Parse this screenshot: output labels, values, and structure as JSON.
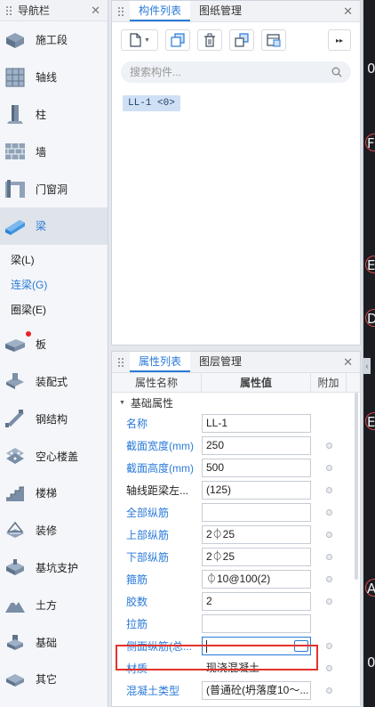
{
  "nav": {
    "title": "导航栏",
    "items": [
      {
        "label": "施工段",
        "icon": "construction-segment-icon"
      },
      {
        "label": "轴线",
        "icon": "axis-grid-icon"
      },
      {
        "label": "柱",
        "icon": "column-icon"
      },
      {
        "label": "墙",
        "icon": "wall-icon"
      },
      {
        "label": "门窗洞",
        "icon": "door-window-icon"
      },
      {
        "label": "梁",
        "icon": "beam-icon"
      },
      {
        "label": "板",
        "icon": "slab-icon"
      },
      {
        "label": "装配式",
        "icon": "prefab-icon"
      },
      {
        "label": "钢结构",
        "icon": "steel-structure-icon"
      },
      {
        "label": "空心楼盖",
        "icon": "hollow-floor-icon"
      },
      {
        "label": "楼梯",
        "icon": "stair-icon"
      },
      {
        "label": "装修",
        "icon": "decoration-icon"
      },
      {
        "label": "基坑支护",
        "icon": "foundation-pit-icon"
      },
      {
        "label": "土方",
        "icon": "earthwork-icon"
      },
      {
        "label": "基础",
        "icon": "foundation-icon"
      },
      {
        "label": "其它",
        "icon": "other-icon"
      }
    ],
    "sub_items": [
      "梁(L)",
      "连梁(G)",
      "圈梁(E)"
    ]
  },
  "component_panel": {
    "tabs": [
      "构件列表",
      "图纸管理"
    ],
    "search_placeholder": "搜索构件...",
    "component": "LL-1 <0>"
  },
  "property_panel": {
    "tabs": [
      "属性列表",
      "图层管理"
    ],
    "headers": {
      "name": "属性名称",
      "value": "属性值",
      "extra": "附加"
    },
    "group": "基础属性",
    "rows": [
      {
        "name": "名称",
        "value": "LL-1"
      },
      {
        "name": "截面宽度(mm)",
        "value": "250"
      },
      {
        "name": "截面高度(mm)",
        "value": "500"
      },
      {
        "name": "轴线距梁左...",
        "value": "(125)"
      },
      {
        "name": "全部纵筋",
        "value": ""
      },
      {
        "name": "上部纵筋",
        "value": "2⏀25"
      },
      {
        "name": "下部纵筋",
        "value": "2⏀25"
      },
      {
        "name": "箍筋",
        "value": "⏀10@100(2)"
      },
      {
        "name": "胶数",
        "value": "2"
      },
      {
        "name": "拉筋",
        "value": ""
      },
      {
        "name": "侧面纵筋(总...",
        "value": ""
      },
      {
        "name": "材质",
        "value": "现浇混凝土"
      },
      {
        "name": "混凝土类型",
        "value": "(普通砼(坍落度10～..."
      }
    ]
  },
  "canvas": {
    "labels": [
      "0",
      "F",
      "E",
      "D",
      "E",
      "A",
      "0"
    ]
  }
}
